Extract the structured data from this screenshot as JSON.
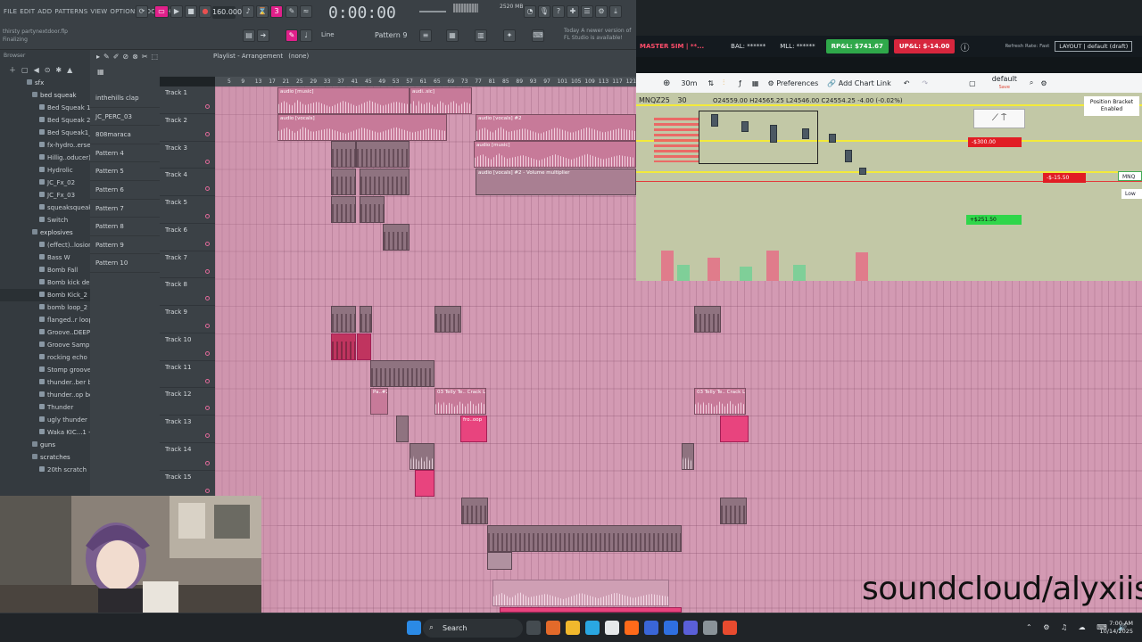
{
  "fl": {
    "menu": [
      "FILE",
      "EDIT",
      "ADD",
      "PATTERNS",
      "VIEW",
      "OPTIONS",
      "TOOLS",
      "HELP"
    ],
    "bpm": "160.000",
    "time": "0:00:00",
    "project_hint": "thirsty partynextdoor.flp",
    "status": "Finalizing",
    "pattern": "Pattern 9",
    "snap": "Line",
    "news": [
      "Today  A newer version of",
      "FL Studio is available!"
    ],
    "cpu": "2520 MB",
    "playlist_title": "Playlist - Arrangement",
    "playlist_sub": "(none)",
    "browser_title": "Browser"
  },
  "browser": {
    "items": [
      {
        "label": "sfx",
        "type": "folder"
      },
      {
        "label": "bed squeak",
        "type": "folder"
      },
      {
        "label": "Bed Squeak 1_2",
        "type": "file"
      },
      {
        "label": "Bed Squeak 2_2",
        "type": "file"
      },
      {
        "label": "Bed Squeak1_2",
        "type": "file"
      },
      {
        "label": "fx-hydro..ersey_2",
        "type": "file"
      },
      {
        "label": "Hillig..oducer)_2",
        "type": "file"
      },
      {
        "label": "Hydrolic",
        "type": "file"
      },
      {
        "label": "JC_Fx_02",
        "type": "file"
      },
      {
        "label": "JC_Fx_03",
        "type": "file"
      },
      {
        "label": "squeaksqueak_2",
        "type": "file"
      },
      {
        "label": "Switch",
        "type": "file"
      },
      {
        "label": "explosives",
        "type": "folder"
      },
      {
        "label": "(effect)..losion_2",
        "type": "file"
      },
      {
        "label": "Bass W",
        "type": "file"
      },
      {
        "label": "Bomb Fall",
        "type": "file"
      },
      {
        "label": "Bomb kick delay",
        "type": "file"
      },
      {
        "label": "Bomb Kick_2",
        "type": "file"
      },
      {
        "label": "bomb loop_2",
        "type": "file"
      },
      {
        "label": "flanged..r loop_2",
        "type": "file"
      },
      {
        "label": "Groove..DEEP_2",
        "type": "file"
      },
      {
        "label": "Groove Sample",
        "type": "file"
      },
      {
        "label": "rocking echo",
        "type": "file"
      },
      {
        "label": "Stomp groove",
        "type": "file"
      },
      {
        "label": "thunder..ber best",
        "type": "file"
      },
      {
        "label": "thunder..op best",
        "type": "file"
      },
      {
        "label": "Thunder",
        "type": "file"
      },
      {
        "label": "ugly thunder",
        "type": "file"
      },
      {
        "label": "Waka KIC...1 - 1",
        "type": "file"
      },
      {
        "label": "guns",
        "type": "folder"
      },
      {
        "label": "scratches",
        "type": "folder"
      },
      {
        "label": "20th scratch",
        "type": "file"
      }
    ]
  },
  "channels": [
    "inthehills clap",
    "JC_PERC_03",
    "808maraca",
    "Pattern 4",
    "Pattern 5",
    "Pattern 6",
    "Pattern 7",
    "Pattern 8",
    "Pattern 9",
    "Pattern 10"
  ],
  "tracks": [
    "Track 1",
    "Track 2",
    "Track 3",
    "Track 4",
    "Track 5",
    "Track 6",
    "Track 7",
    "Track 8",
    "Track 9",
    "Track 10",
    "Track 11",
    "Track 12",
    "Track 13",
    "Track 14",
    "Track 15"
  ],
  "ruler": [
    "5",
    "9",
    "13",
    "17",
    "21",
    "25",
    "29",
    "33",
    "37",
    "41",
    "45",
    "49",
    "53",
    "57",
    "61",
    "65",
    "69",
    "73",
    "77",
    "81",
    "85",
    "89",
    "93",
    "97",
    "101",
    "105",
    "109",
    "113",
    "117",
    "121"
  ],
  "clips": {
    "audio_music": "audio [music]",
    "audio_music_short": "audi..sic]",
    "audio_vocals": "audio [vocals]",
    "audio_vocals2": "audio [vocals] #2",
    "audio_music2": "audio [music]",
    "vol_mult": "audio [vocals] #2 - Volume multiplier",
    "crack_loop": "03 Telly Te.. Crack Loop",
    "crack_loop2": "03 Telly Te.. Crack Loop",
    "fro_loop": "fro..oop",
    "pa2": "Pa..#2"
  },
  "trading": {
    "account": "MASTER SIM | **...",
    "bal": "BAL: ******",
    "mll": "MLL: ******",
    "rp_l": "RP&L: $741.67",
    "up_l": "UP&L: $-14.00",
    "refresh": "Refresh Rate: Fast",
    "layout": "LAYOUT | default (draft)",
    "timeframe": "30m",
    "preferences": "Preferences",
    "add_chart_link": "Add Chart Link",
    "default_label": "default",
    "save_label": "Save",
    "symbol": "MNQZ25",
    "symbol_tf": "30",
    "ohlc": "O24559.00  H24565.25  L24546.00  C24554.25  -4.00 (-0.02%)",
    "position_bracket": "Position Bracket",
    "enabled": "Enabled",
    "tag_red": "-$300.00",
    "tag_stop": "-$-15.50",
    "tag_green": "+$251.50",
    "mnq": "MNQ",
    "low": "Low"
  },
  "watermark": "soundcloud/alyxiis",
  "taskbar": {
    "search": "Search",
    "time": "7:00 AM",
    "date": "10/14/2025"
  },
  "colors": {
    "playlist_bg": "#d39ab3",
    "clip_hot": "#e8447e",
    "rpl_green": "#2fa84a",
    "upl_red": "#d7263d",
    "fl_accent": "#e0208a"
  }
}
